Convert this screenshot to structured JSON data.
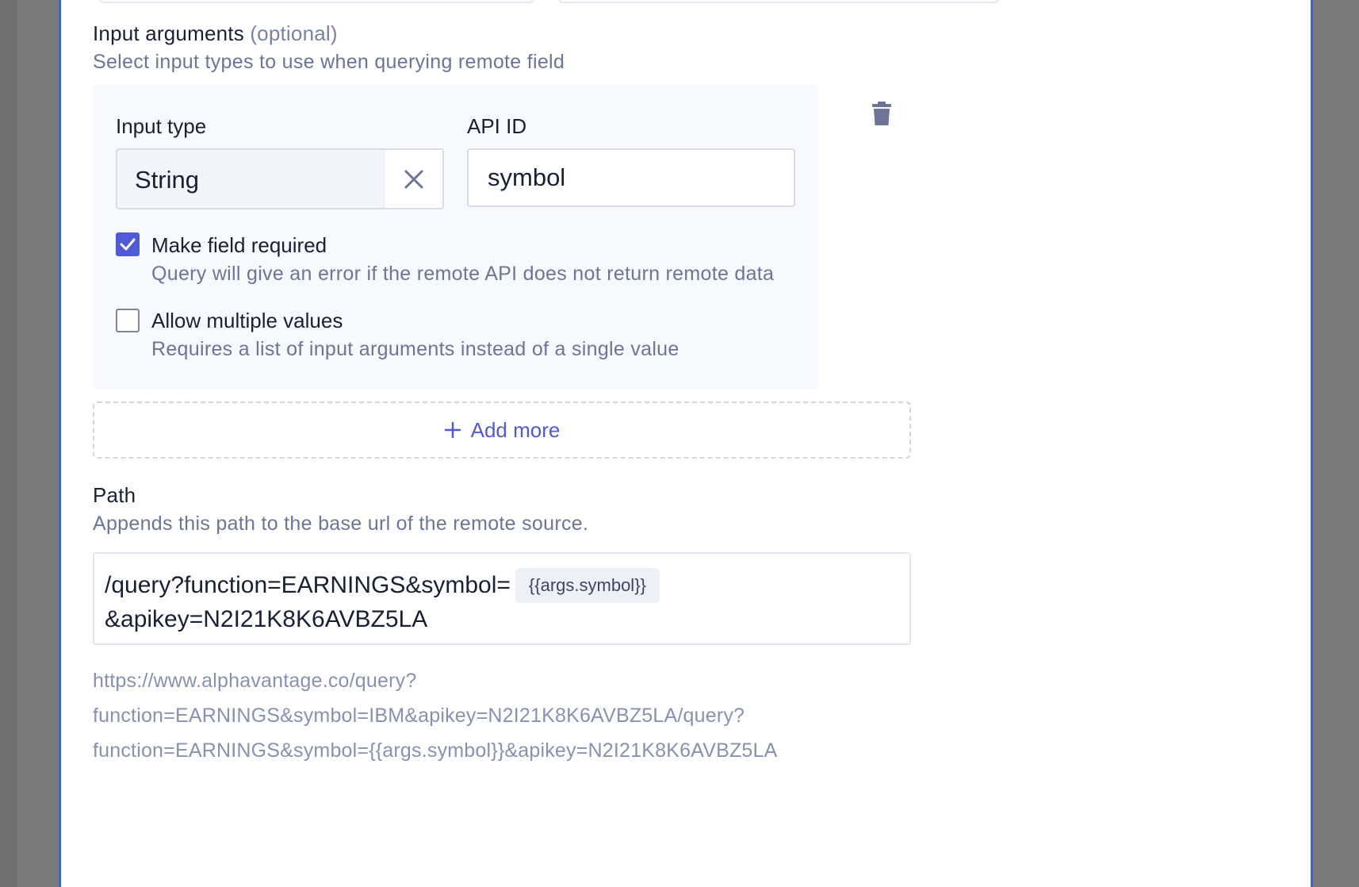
{
  "input_arguments": {
    "title": "Input arguments",
    "optional_tag": "(optional)",
    "description": "Select input types to use when querying remote field",
    "argument": {
      "input_type_label": "Input type",
      "input_type_value": "String",
      "api_id_label": "API ID",
      "api_id_value": "symbol",
      "required": {
        "label": "Make field required",
        "description": "Query will give an error if the remote API does not return remote data",
        "checked": true
      },
      "multiple": {
        "label": "Allow multiple values",
        "description": "Requires a list of input arguments instead of a single value",
        "checked": false
      }
    },
    "add_more_label": "Add more"
  },
  "path": {
    "title": "Path",
    "description": "Appends this path to the base url of the remote source.",
    "value_prefix": "/query?function=EARNINGS&symbol=",
    "token": "{{args.symbol}}",
    "value_suffix": "&apikey=N2I21K8K6AVBZ5LA",
    "preview_lines": [
      "https://www.alphavantage.co/query?",
      "function=EARNINGS&symbol=IBM&apikey=N2I21K8K6AVBZ5LA/query?",
      "function=EARNINGS&symbol={{args.symbol}}&apikey=N2I21K8K6AVBZ5LA"
    ]
  },
  "colors": {
    "accent": "#4f5bd5",
    "frame_border": "#3b67c9",
    "muted_text": "#6d7597"
  }
}
